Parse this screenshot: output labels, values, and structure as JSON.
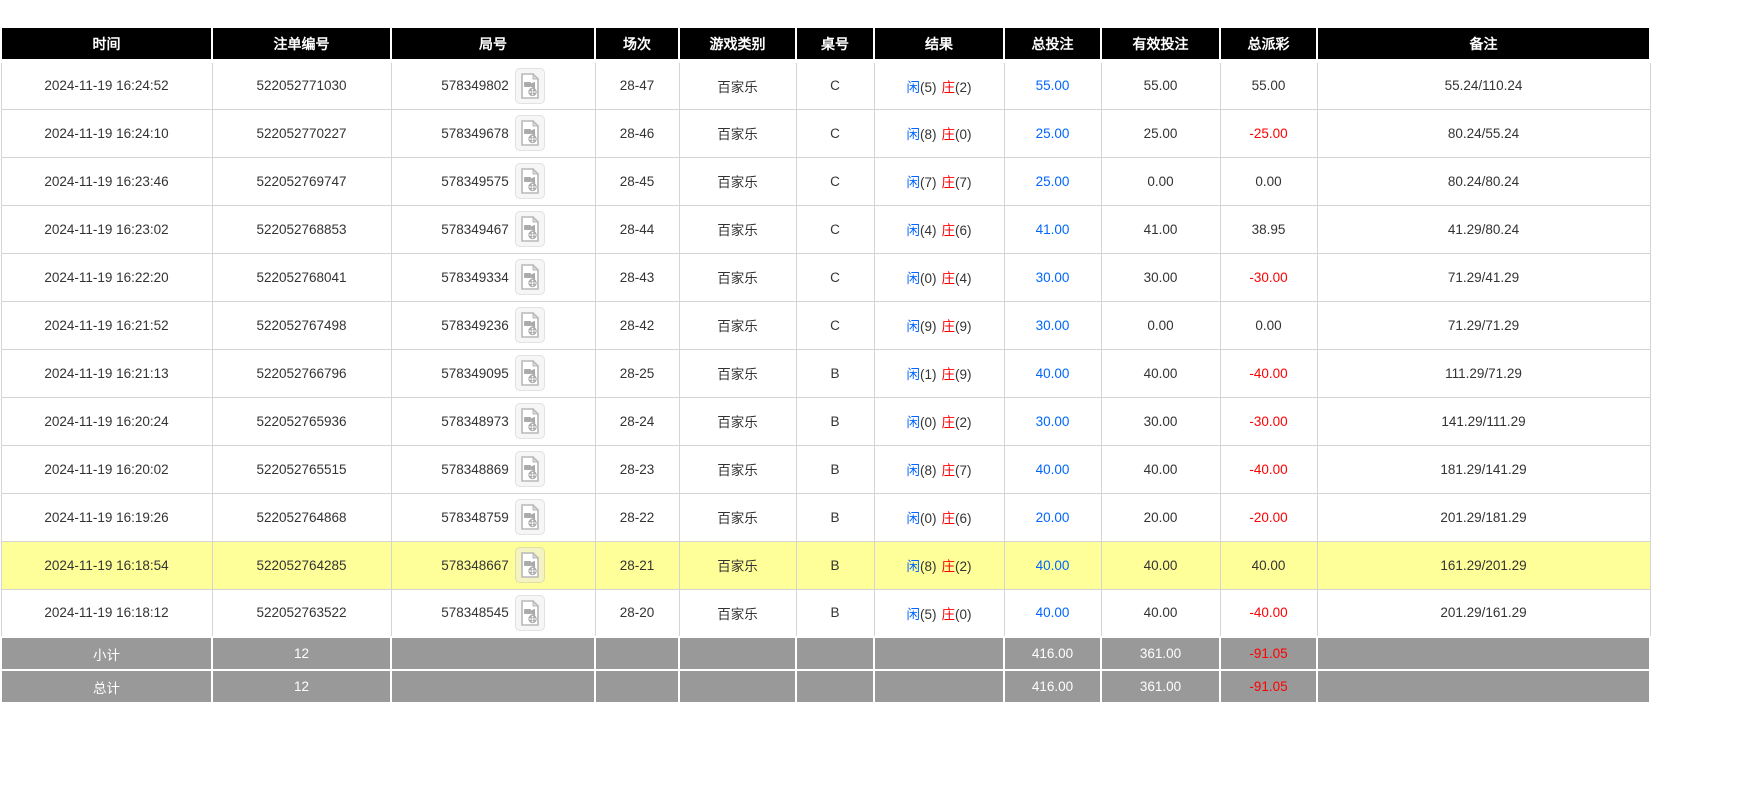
{
  "colors": {
    "header_bg": "#000000",
    "header_text": "#ffffff",
    "row_text": "#333333",
    "player_blue": "#0066ff",
    "banker_red": "#ff0000",
    "negative_red": "#ff0000",
    "highlight_row_bg": "#ffff99",
    "footer_bg": "#999999",
    "footer_text": "#ffffff"
  },
  "table": {
    "columns": [
      {
        "key": "time",
        "label": "时间"
      },
      {
        "key": "bet_no",
        "label": "注单编号"
      },
      {
        "key": "round_no",
        "label": "局号"
      },
      {
        "key": "session",
        "label": "场次"
      },
      {
        "key": "game_type",
        "label": "游戏类别"
      },
      {
        "key": "table_no",
        "label": "桌号"
      },
      {
        "key": "result",
        "label": "结果"
      },
      {
        "key": "total_bet",
        "label": "总投注"
      },
      {
        "key": "valid_bet",
        "label": "有效投注"
      },
      {
        "key": "payout",
        "label": "总派彩"
      },
      {
        "key": "remark",
        "label": "备注"
      }
    ],
    "video_icon_name": "video-replay-icon",
    "rows": [
      {
        "time": "2024-11-19 16:24:52",
        "bet_no": "522052771030",
        "round_no": "578349802",
        "session": "28-47",
        "game_type": "百家乐",
        "table_no": "C",
        "result": {
          "player_label": "闲",
          "player_score": "(5)",
          "banker_label": "庄",
          "banker_score": "(2)"
        },
        "total_bet": "55.00",
        "valid_bet": "55.00",
        "payout": "55.00",
        "remark": "55.24/110.24",
        "highlighted": false
      },
      {
        "time": "2024-11-19 16:24:10",
        "bet_no": "522052770227",
        "round_no": "578349678",
        "session": "28-46",
        "game_type": "百家乐",
        "table_no": "C",
        "result": {
          "player_label": "闲",
          "player_score": "(8)",
          "banker_label": "庄",
          "banker_score": "(0)"
        },
        "total_bet": "25.00",
        "valid_bet": "25.00",
        "payout": "-25.00",
        "remark": "80.24/55.24",
        "highlighted": false
      },
      {
        "time": "2024-11-19 16:23:46",
        "bet_no": "522052769747",
        "round_no": "578349575",
        "session": "28-45",
        "game_type": "百家乐",
        "table_no": "C",
        "result": {
          "player_label": "闲",
          "player_score": "(7)",
          "banker_label": "庄",
          "banker_score": "(7)"
        },
        "total_bet": "25.00",
        "valid_bet": "0.00",
        "payout": "0.00",
        "remark": "80.24/80.24",
        "highlighted": false
      },
      {
        "time": "2024-11-19 16:23:02",
        "bet_no": "522052768853",
        "round_no": "578349467",
        "session": "28-44",
        "game_type": "百家乐",
        "table_no": "C",
        "result": {
          "player_label": "闲",
          "player_score": "(4)",
          "banker_label": "庄",
          "banker_score": "(6)"
        },
        "total_bet": "41.00",
        "valid_bet": "41.00",
        "payout": "38.95",
        "remark": "41.29/80.24",
        "highlighted": false
      },
      {
        "time": "2024-11-19 16:22:20",
        "bet_no": "522052768041",
        "round_no": "578349334",
        "session": "28-43",
        "game_type": "百家乐",
        "table_no": "C",
        "result": {
          "player_label": "闲",
          "player_score": "(0)",
          "banker_label": "庄",
          "banker_score": "(4)"
        },
        "total_bet": "30.00",
        "valid_bet": "30.00",
        "payout": "-30.00",
        "remark": "71.29/41.29",
        "highlighted": false
      },
      {
        "time": "2024-11-19 16:21:52",
        "bet_no": "522052767498",
        "round_no": "578349236",
        "session": "28-42",
        "game_type": "百家乐",
        "table_no": "C",
        "result": {
          "player_label": "闲",
          "player_score": "(9)",
          "banker_label": "庄",
          "banker_score": "(9)"
        },
        "total_bet": "30.00",
        "valid_bet": "0.00",
        "payout": "0.00",
        "remark": "71.29/71.29",
        "highlighted": false
      },
      {
        "time": "2024-11-19 16:21:13",
        "bet_no": "522052766796",
        "round_no": "578349095",
        "session": "28-25",
        "game_type": "百家乐",
        "table_no": "B",
        "result": {
          "player_label": "闲",
          "player_score": "(1)",
          "banker_label": "庄",
          "banker_score": "(9)"
        },
        "total_bet": "40.00",
        "valid_bet": "40.00",
        "payout": "-40.00",
        "remark": "111.29/71.29",
        "highlighted": false
      },
      {
        "time": "2024-11-19 16:20:24",
        "bet_no": "522052765936",
        "round_no": "578348973",
        "session": "28-24",
        "game_type": "百家乐",
        "table_no": "B",
        "result": {
          "player_label": "闲",
          "player_score": "(0)",
          "banker_label": "庄",
          "banker_score": "(2)"
        },
        "total_bet": "30.00",
        "valid_bet": "30.00",
        "payout": "-30.00",
        "remark": "141.29/111.29",
        "highlighted": false
      },
      {
        "time": "2024-11-19 16:20:02",
        "bet_no": "522052765515",
        "round_no": "578348869",
        "session": "28-23",
        "game_type": "百家乐",
        "table_no": "B",
        "result": {
          "player_label": "闲",
          "player_score": "(8)",
          "banker_label": "庄",
          "banker_score": "(7)"
        },
        "total_bet": "40.00",
        "valid_bet": "40.00",
        "payout": "-40.00",
        "remark": "181.29/141.29",
        "highlighted": false
      },
      {
        "time": "2024-11-19 16:19:26",
        "bet_no": "522052764868",
        "round_no": "578348759",
        "session": "28-22",
        "game_type": "百家乐",
        "table_no": "B",
        "result": {
          "player_label": "闲",
          "player_score": "(0)",
          "banker_label": "庄",
          "banker_score": "(6)"
        },
        "total_bet": "20.00",
        "valid_bet": "20.00",
        "payout": "-20.00",
        "remark": "201.29/181.29",
        "highlighted": false
      },
      {
        "time": "2024-11-19 16:18:54",
        "bet_no": "522052764285",
        "round_no": "578348667",
        "session": "28-21",
        "game_type": "百家乐",
        "table_no": "B",
        "result": {
          "player_label": "闲",
          "player_score": "(8)",
          "banker_label": "庄",
          "banker_score": "(2)"
        },
        "total_bet": "40.00",
        "valid_bet": "40.00",
        "payout": "40.00",
        "remark": "161.29/201.29",
        "highlighted": true
      },
      {
        "time": "2024-11-19 16:18:12",
        "bet_no": "522052763522",
        "round_no": "578348545",
        "session": "28-20",
        "game_type": "百家乐",
        "table_no": "B",
        "result": {
          "player_label": "闲",
          "player_score": "(5)",
          "banker_label": "庄",
          "banker_score": "(0)"
        },
        "total_bet": "40.00",
        "valid_bet": "40.00",
        "payout": "-40.00",
        "remark": "201.29/161.29",
        "highlighted": false
      }
    ],
    "footer_rows": [
      {
        "label": "小计",
        "count": "12",
        "total_bet": "416.00",
        "valid_bet": "361.00",
        "payout": "-91.05",
        "remark": ""
      },
      {
        "label": "总计",
        "count": "12",
        "total_bet": "416.00",
        "valid_bet": "361.00",
        "payout": "-91.05",
        "remark": ""
      }
    ]
  }
}
